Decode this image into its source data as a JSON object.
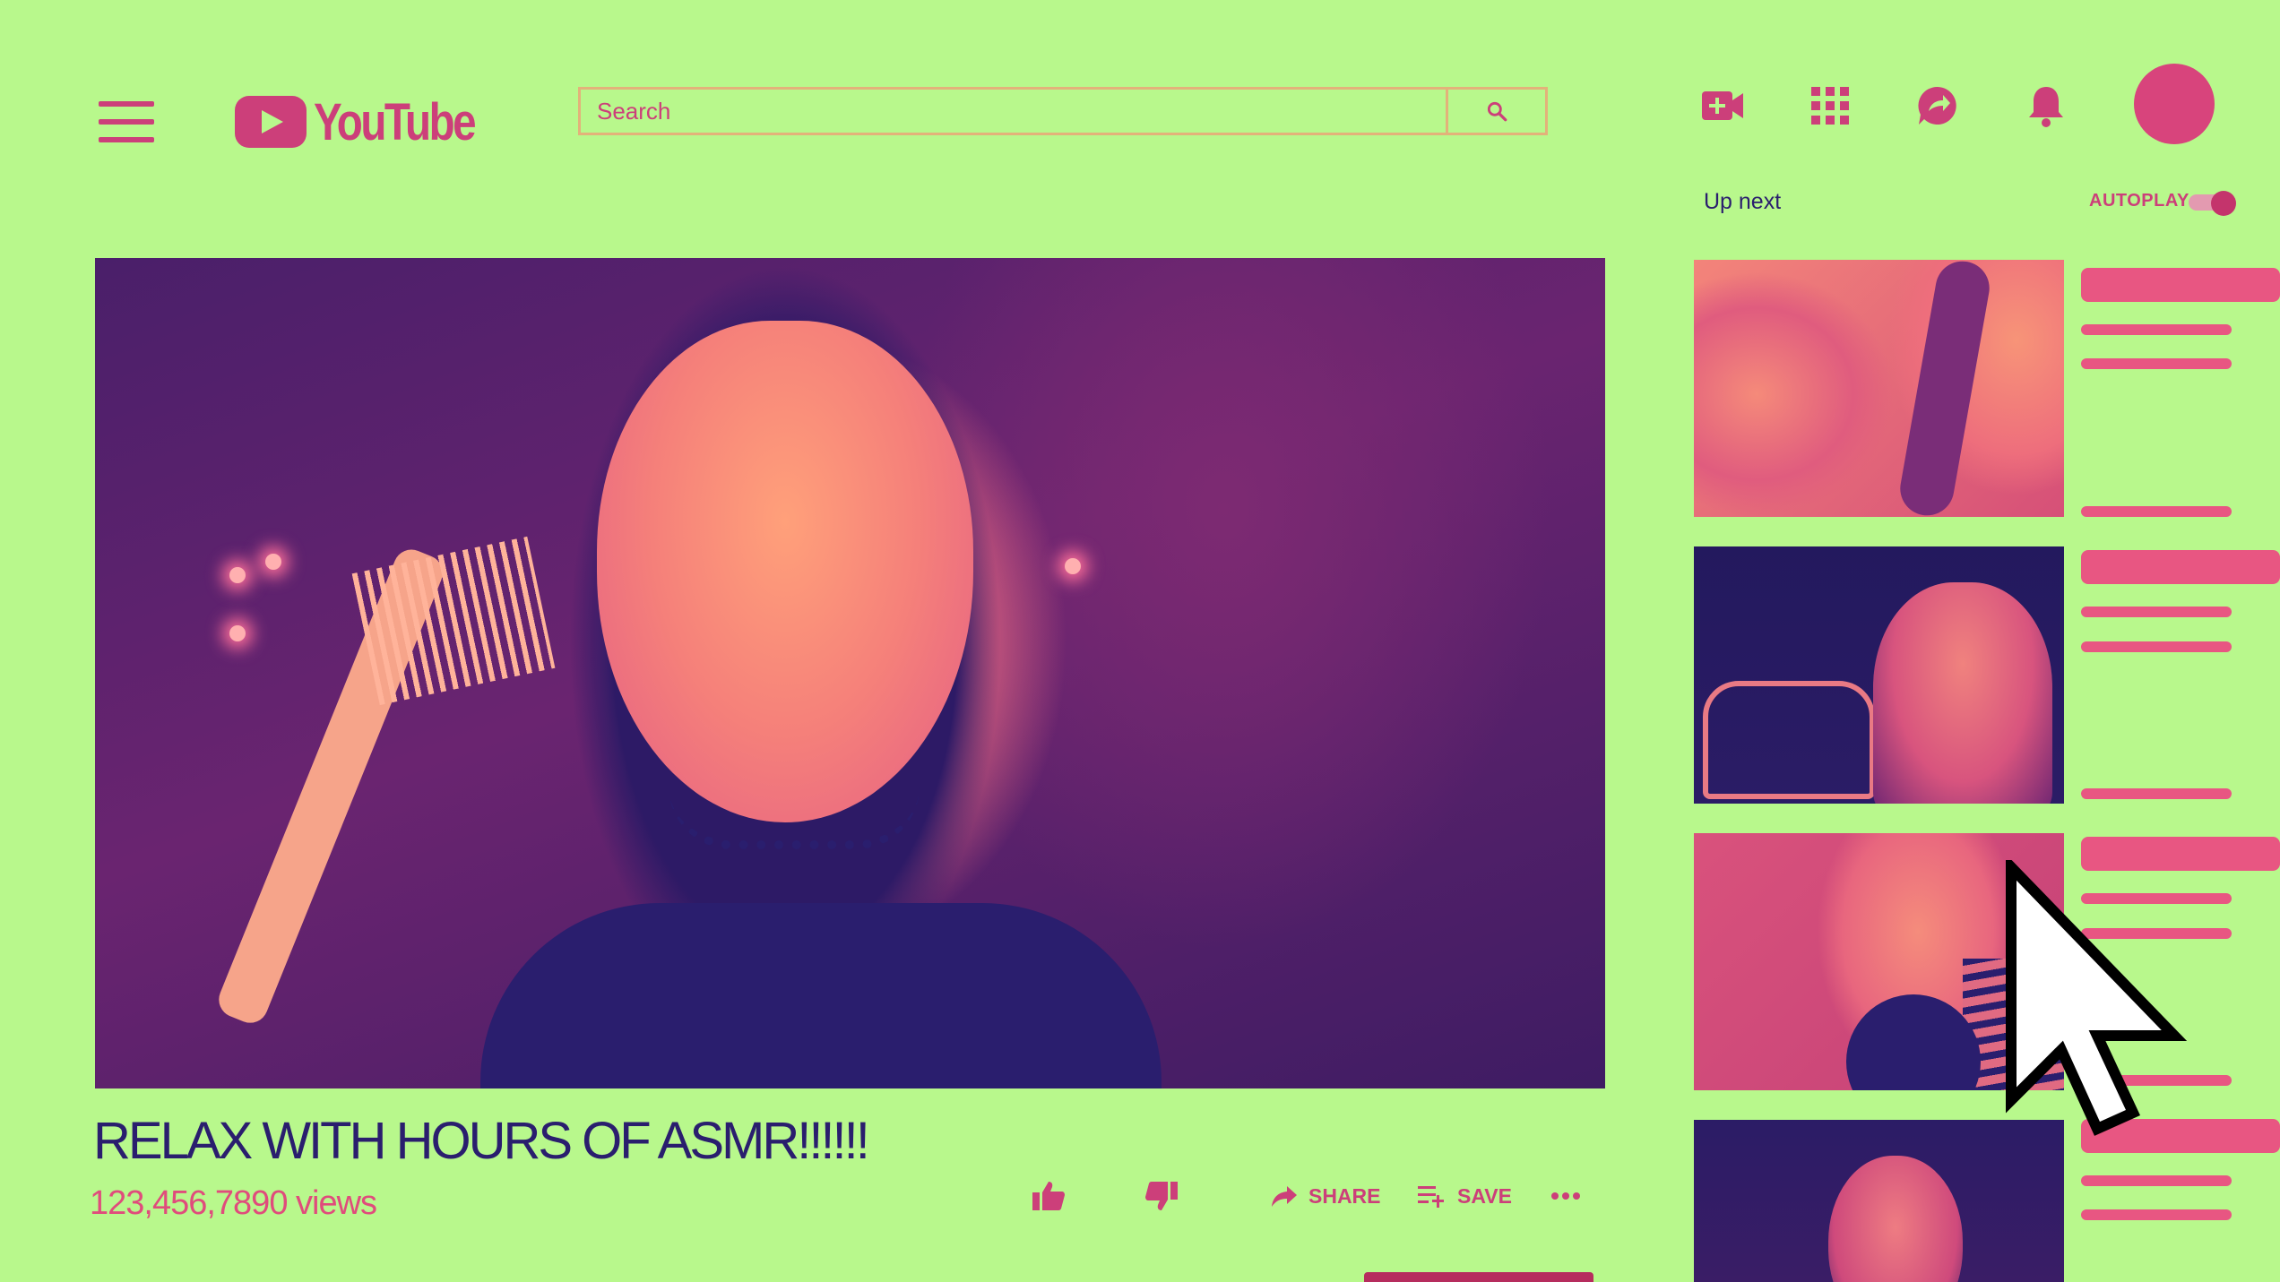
{
  "header": {
    "logo_text": "YouTube",
    "search_placeholder": "Search"
  },
  "upnext": {
    "label": "Up next",
    "autoplay_label": "AUTOPLAY",
    "autoplay_on": true
  },
  "video": {
    "title": "RELAX WITH HOURS OF ASMR!!!!!!",
    "views": "123,456,7890 views"
  },
  "actions": {
    "share_label": "SHARE",
    "save_label": "SAVE"
  },
  "colors": {
    "background": "#b8f88c",
    "accent": "#cc3f7a",
    "dark": "#2a1e6e"
  },
  "icons": [
    "menu-icon",
    "search-icon",
    "create-video-icon",
    "apps-icon",
    "messages-icon",
    "notifications-icon",
    "like-icon",
    "dislike-icon",
    "share-icon",
    "save-playlist-icon",
    "more-icon",
    "mouse-pointer-icon"
  ]
}
